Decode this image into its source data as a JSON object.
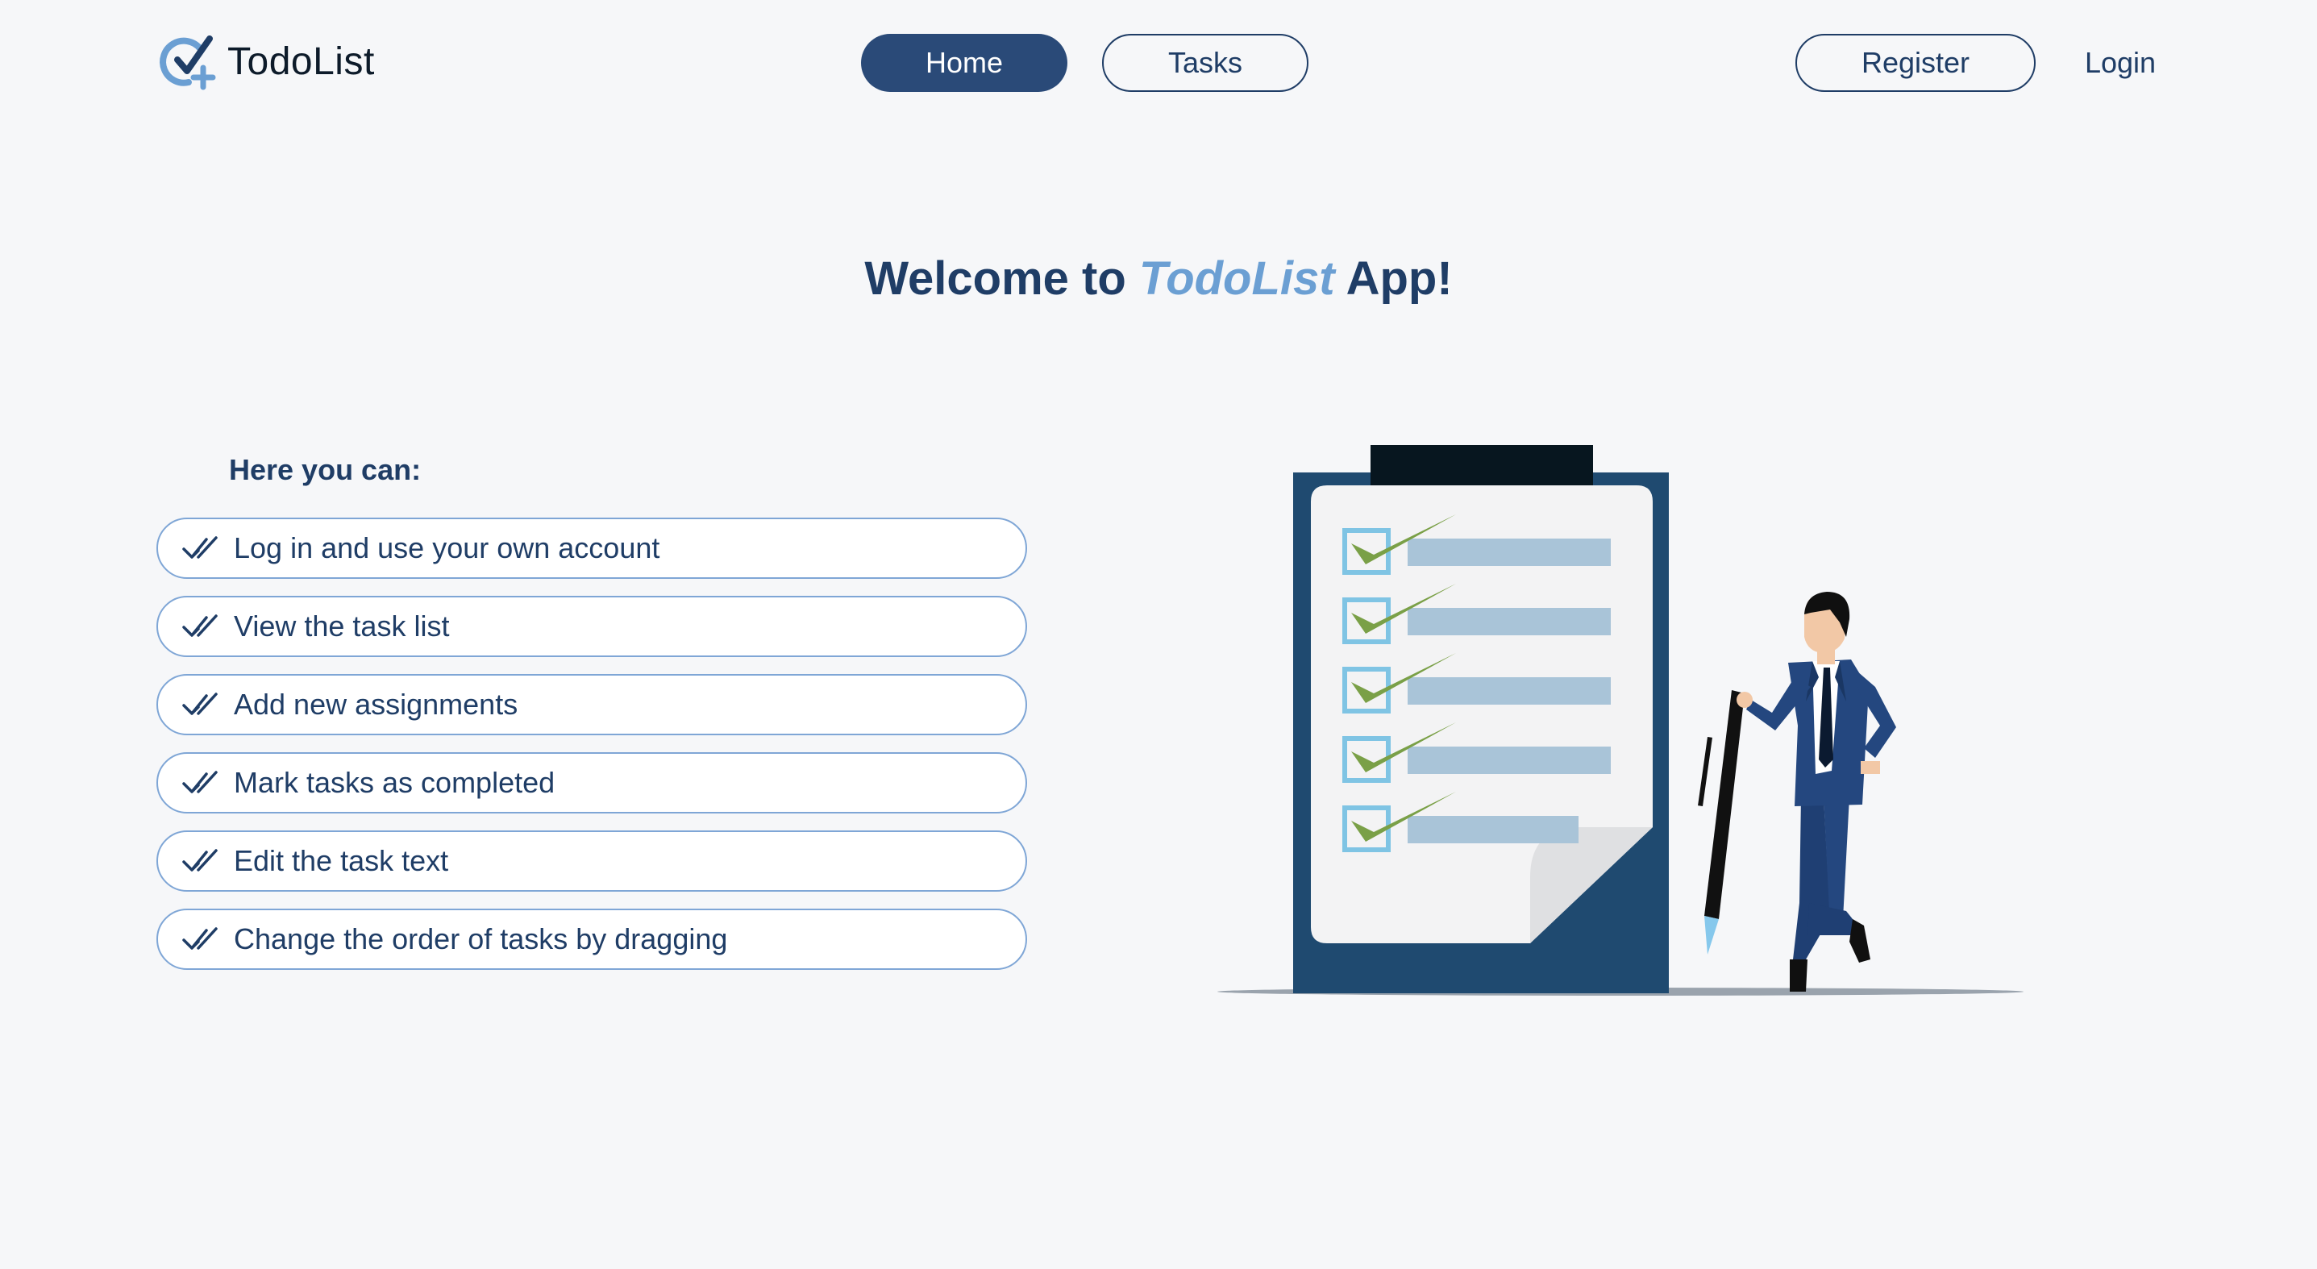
{
  "header": {
    "logo_text": "TodoList",
    "nav": {
      "home": "Home",
      "tasks": "Tasks"
    },
    "auth": {
      "register": "Register",
      "login": "Login"
    }
  },
  "hero": {
    "welcome_prefix": "Welcome to ",
    "welcome_brand": "TodoList",
    "welcome_suffix": " App!"
  },
  "features": {
    "heading": "Here you can:",
    "items": [
      "Log in and use your own account",
      "View the task list",
      "Add new assignments",
      "Mark tasks as completed",
      "Edit the task text",
      "Change the order of tasks by dragging"
    ]
  },
  "icons": {
    "logo": "check-circle-plus-icon",
    "feature_bullet": "double-check-icon"
  },
  "colors": {
    "background": "#f6f7f9",
    "primary": "#2a4a78",
    "text": "#1f3d66",
    "accent": "#6b9fd3"
  }
}
